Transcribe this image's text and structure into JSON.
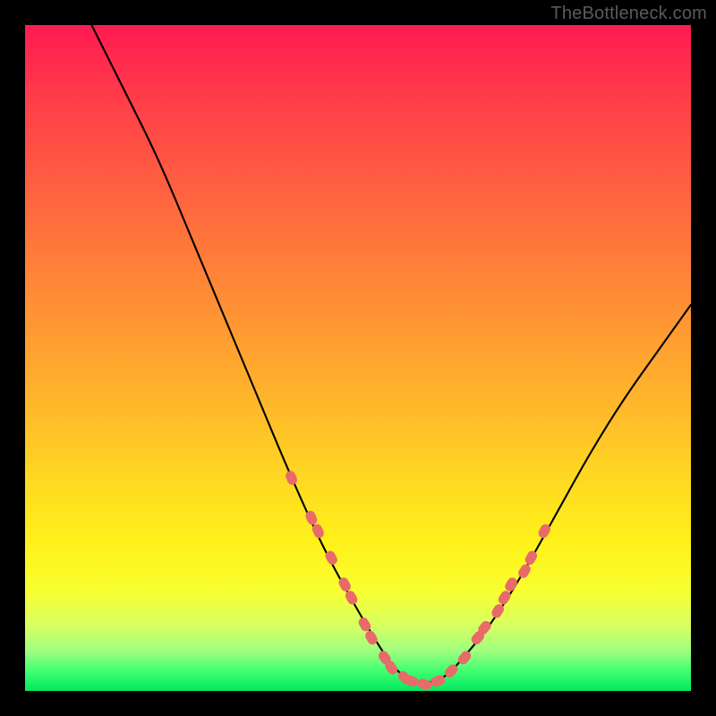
{
  "watermark": "TheBottleneck.com",
  "chart_data": {
    "type": "line",
    "title": "",
    "xlabel": "",
    "ylabel": "",
    "xlim": [
      0,
      100
    ],
    "ylim": [
      0,
      100
    ],
    "grid": false,
    "legend": false,
    "curve_stroke": "#000000",
    "marker_color": "#e86a6a",
    "series": [
      {
        "name": "bottleneck-curve",
        "x": [
          10,
          15,
          20,
          25,
          30,
          35,
          40,
          45,
          50,
          53,
          55,
          57,
          60,
          63,
          65,
          70,
          75,
          80,
          85,
          90,
          95,
          100
        ],
        "y": [
          100,
          90,
          80,
          68,
          56,
          44,
          32,
          21,
          12,
          7,
          4,
          2,
          1,
          2,
          4,
          10,
          18,
          27,
          36,
          44,
          51,
          58
        ]
      }
    ],
    "markers": [
      {
        "x": 40,
        "y": 32
      },
      {
        "x": 43,
        "y": 26
      },
      {
        "x": 44,
        "y": 24
      },
      {
        "x": 46,
        "y": 20
      },
      {
        "x": 48,
        "y": 16
      },
      {
        "x": 49,
        "y": 14
      },
      {
        "x": 51,
        "y": 10
      },
      {
        "x": 52,
        "y": 8
      },
      {
        "x": 54,
        "y": 5
      },
      {
        "x": 55,
        "y": 3.5
      },
      {
        "x": 57,
        "y": 2
      },
      {
        "x": 58,
        "y": 1.5
      },
      {
        "x": 60,
        "y": 1
      },
      {
        "x": 62,
        "y": 1.5
      },
      {
        "x": 64,
        "y": 3
      },
      {
        "x": 66,
        "y": 5
      },
      {
        "x": 68,
        "y": 8
      },
      {
        "x": 69,
        "y": 9.5
      },
      {
        "x": 71,
        "y": 12
      },
      {
        "x": 72,
        "y": 14
      },
      {
        "x": 73,
        "y": 16
      },
      {
        "x": 75,
        "y": 18
      },
      {
        "x": 76,
        "y": 20
      },
      {
        "x": 78,
        "y": 24
      }
    ]
  }
}
